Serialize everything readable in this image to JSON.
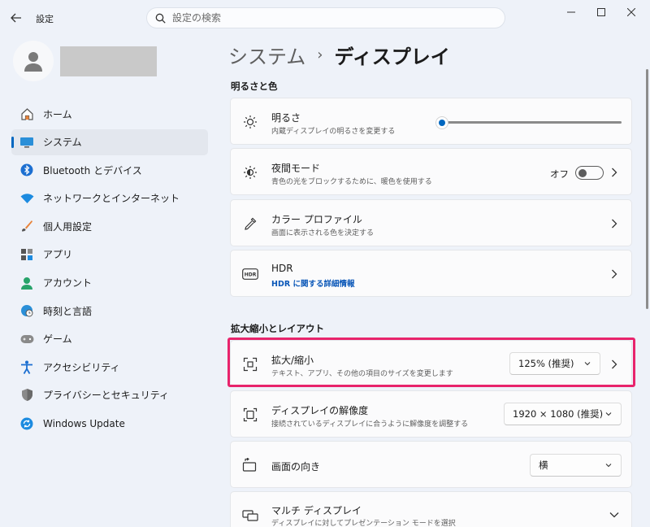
{
  "window": {
    "app_title": "設定",
    "controls": [
      "minimize-icon",
      "maximize-icon",
      "close-icon"
    ]
  },
  "search": {
    "placeholder": "設定の検索"
  },
  "sidebar": {
    "items": [
      {
        "label": "ホーム",
        "icon": "home-icon"
      },
      {
        "label": "システム",
        "icon": "system-icon",
        "active": true
      },
      {
        "label": "Bluetooth とデバイス",
        "icon": "bluetooth-icon"
      },
      {
        "label": "ネットワークとインターネット",
        "icon": "wifi-icon"
      },
      {
        "label": "個人用設定",
        "icon": "brush-icon"
      },
      {
        "label": "アプリ",
        "icon": "apps-icon"
      },
      {
        "label": "アカウント",
        "icon": "account-icon"
      },
      {
        "label": "時刻と言語",
        "icon": "globe-clock-icon"
      },
      {
        "label": "ゲーム",
        "icon": "gamepad-icon"
      },
      {
        "label": "アクセシビリティ",
        "icon": "accessibility-icon"
      },
      {
        "label": "プライバシーとセキュリティ",
        "icon": "shield-icon"
      },
      {
        "label": "Windows Update",
        "icon": "update-icon"
      }
    ]
  },
  "header": {
    "parent": "システム",
    "separator": "›",
    "current": "ディスプレイ"
  },
  "sections": {
    "brightness_color": "明るさと色",
    "scale_layout": "拡大縮小とレイアウト"
  },
  "cards": {
    "brightness": {
      "title": "明るさ",
      "desc": "内蔵ディスプレイの明るさを変更する",
      "value_fraction": 0.0
    },
    "night_light": {
      "title": "夜間モード",
      "desc": "青色の光をブロックするために、暖色を使用する",
      "state": "オフ"
    },
    "color_profile": {
      "title": "カラー プロファイル",
      "desc": "画面に表示される色を決定する"
    },
    "hdr": {
      "title": "HDR",
      "link": "HDR に関する詳細情報",
      "icon_label": "HDR"
    },
    "scale": {
      "title": "拡大/縮小",
      "desc": "テキスト、アプリ、その他の項目のサイズを変更します",
      "value": "125% (推奨)"
    },
    "resolution": {
      "title": "ディスプレイの解像度",
      "desc": "接続されているディスプレイに合うように解像度を調整する",
      "value": "1920 × 1080 (推奨)"
    },
    "orientation": {
      "title": "画面の向き",
      "value": "横"
    },
    "multi_display": {
      "title": "マルチ ディスプレイ",
      "desc": "ディスプレイに対してプレゼンテーション モードを選択"
    }
  },
  "colors": {
    "accent": "#0067c0",
    "highlight": "#e8246c"
  }
}
